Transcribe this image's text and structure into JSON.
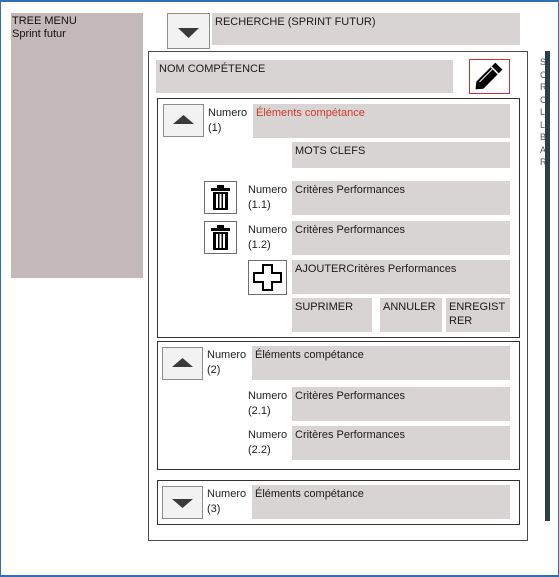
{
  "tree_menu": {
    "title": "TREE MENU",
    "subtitle": "Sprint futur"
  },
  "search": {
    "label": "RECHERCHE (SPRINT FUTUR)"
  },
  "competence": {
    "name_placeholder": "NOM COMPÉTENCE"
  },
  "side_text": [
    "S",
    "C",
    "R",
    "C",
    "L",
    "L",
    "B",
    "A",
    "R"
  ],
  "groups": [
    {
      "numero": "Numero (1)",
      "element_label": "Éléments compétance",
      "keywords": "MOTS CLEFS",
      "criteres": [
        {
          "numero": "Numero (1.1)",
          "label": "Critères Performances"
        },
        {
          "numero": "Numero (1.2)",
          "label": "Critères Performances"
        }
      ],
      "add_label": "AJOUTERCritères Performances",
      "actions": {
        "delete": "SUPRIMER",
        "cancel": "ANNULER",
        "save": "ENREGISTRER"
      }
    },
    {
      "numero": "Numero (2)",
      "element_label": "Éléments compétance",
      "criteres": [
        {
          "numero": "Numero (2.1)",
          "label": "Critères Performances"
        },
        {
          "numero": "Numero (2.2)",
          "label": "Critères Performances"
        }
      ]
    },
    {
      "numero": "Numero (3)",
      "element_label": "Éléments compétance"
    }
  ],
  "colors": {
    "accent_red": "#d13b2c",
    "field_bg": "#d9d4d4",
    "menu_bg": "#c4b8b8",
    "frame_blue": "#2f6fb4"
  }
}
